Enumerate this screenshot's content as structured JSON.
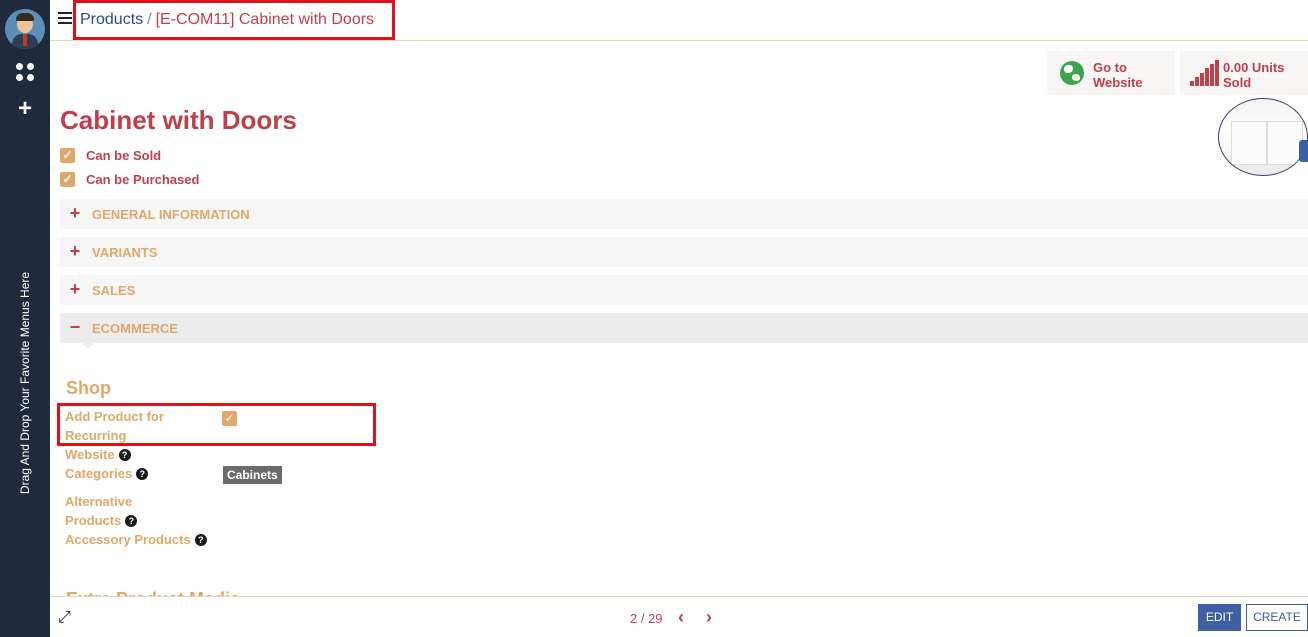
{
  "breadcrumb": {
    "parent": "Products",
    "separator": "/",
    "current": "[E-COM11] Cabinet with Doors"
  },
  "sidebar": {
    "favorites_hint": "Drag And Drop Your Favorite Menus Here"
  },
  "smart_buttons": {
    "website": {
      "line1": "Go to",
      "line2": "Website"
    },
    "sold": {
      "line1": "0.00 Units",
      "line2": "Sold"
    }
  },
  "product": {
    "name": "Cabinet with Doors",
    "can_be_sold": "Can be Sold",
    "can_be_purchased": "Can be Purchased"
  },
  "sections": [
    {
      "label": "GENERAL INFORMATION",
      "sign": "+"
    },
    {
      "label": "VARIANTS",
      "sign": "+"
    },
    {
      "label": "SALES",
      "sign": "+"
    },
    {
      "label": "ECOMMERCE",
      "sign": "−"
    }
  ],
  "ecommerce": {
    "shop_title": "Shop",
    "add_product_recurring_1": "Add Product for",
    "add_product_recurring_2": "Recurring",
    "website_label": "Website",
    "categories_label": "Categories",
    "category_tag": "Cabinets",
    "alternative_1": "Alternative",
    "alternative_2": "Products",
    "accessory": "Accessory Products",
    "extra_media": "Extra Product Media"
  },
  "pager": {
    "text": "2 / 29",
    "prev": "‹",
    "next": "›"
  },
  "buttons": {
    "edit": "EDIT",
    "create": "CREATE"
  },
  "colors": {
    "sidebar": "#1f2a3d",
    "primary": "#3f5fa3",
    "accent_red": "#c0404a",
    "accent_orange": "#e0a86a",
    "highlight": "#e0101a"
  }
}
